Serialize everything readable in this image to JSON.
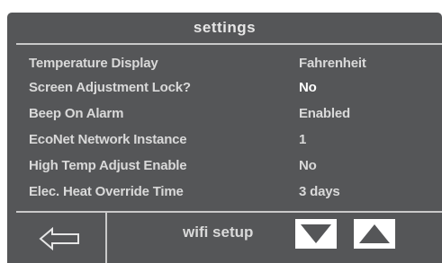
{
  "header": {
    "title": "settings"
  },
  "settings": [
    {
      "label": "Temperature Display",
      "value": "Fahrenheit",
      "highlighted": false
    },
    {
      "label": "Screen Adjustment Lock?",
      "value": "No",
      "highlighted": true
    },
    {
      "label": "Beep On Alarm",
      "value": "Enabled",
      "highlighted": false
    },
    {
      "label": "EcoNet Network Instance",
      "value": "1",
      "highlighted": false
    },
    {
      "label": "High Temp Adjust Enable",
      "value": "No",
      "highlighted": false
    },
    {
      "label": "Elec. Heat Override Time",
      "value": "3 days",
      "highlighted": false
    }
  ],
  "footer": {
    "back_icon": "left-arrow-icon",
    "wifi_label": "wifi setup",
    "down_icon": "triangle-down-icon",
    "up_icon": "triangle-up-icon"
  },
  "colors": {
    "panel_bg": "#555658",
    "text": "#d9d9d9",
    "highlight_text": "#ffffff",
    "divider": "#c9c9c9"
  }
}
